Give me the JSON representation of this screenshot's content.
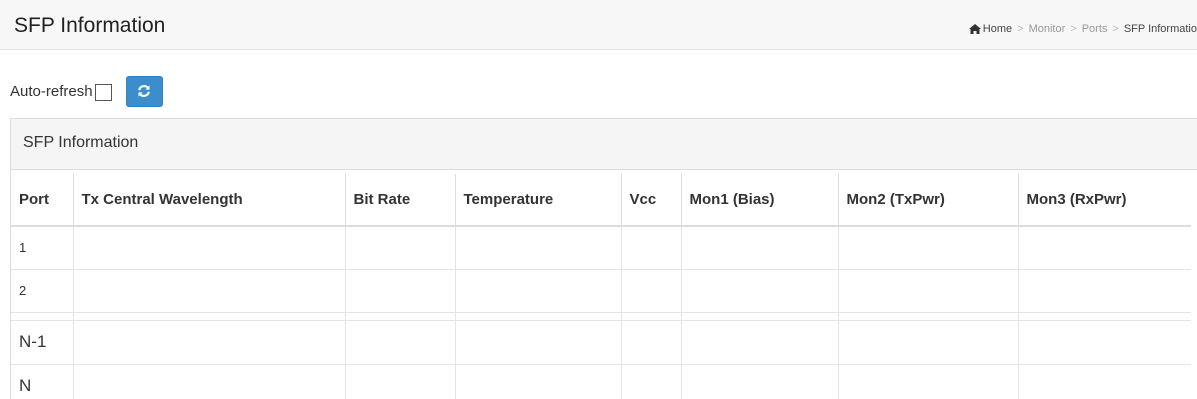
{
  "header": {
    "title": "SFP Information",
    "breadcrumb": {
      "home": "Home",
      "items": [
        "Monitor",
        "Ports"
      ],
      "current": "SFP Informatio"
    }
  },
  "toolbar": {
    "autorefresh_label": "Auto-refresh",
    "autorefresh_checked": false,
    "refresh_icon": "refresh-icon"
  },
  "panel": {
    "heading": "SFP Information",
    "columns": [
      "Port",
      "Tx Central Wavelength",
      "Bit Rate",
      "Temperature",
      "Vcc",
      "Mon1 (Bias)",
      "Mon2 (TxPwr)",
      "Mon3 (RxPwr)"
    ],
    "rows": [
      {
        "port": "1"
      },
      {
        "port": "2"
      },
      {
        "port": "N-1"
      },
      {
        "port": "N"
      }
    ]
  },
  "colors": {
    "accent": "#3c8dcc",
    "header_bg": "#f7f7f7",
    "panel_heading_bg": "#f5f5f5"
  }
}
